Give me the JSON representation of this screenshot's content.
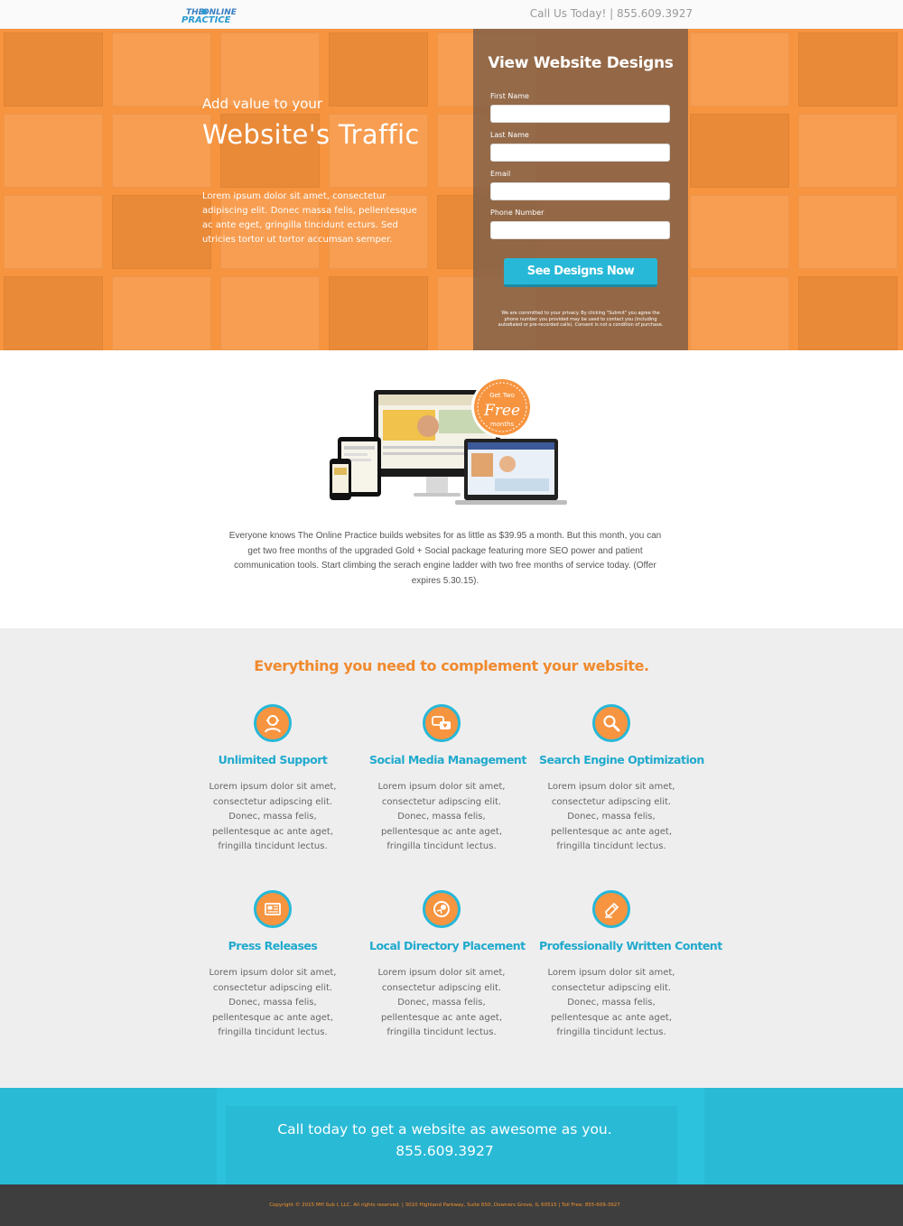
{
  "header": {
    "logo_alt": "The Online Practice",
    "call": "Call Us Today! | 855.609.3927"
  },
  "hero": {
    "pre_title": "Add value to your",
    "title": "Website's Traffic",
    "body": "Lorem ipsum dolor sit amet, consectetur adipiscing elit. Donec massa felis, pellentesque ac ante eget, gringilla tincidunt ecturs. Sed utricies tortor ut tortor accumsan semper."
  },
  "form": {
    "title": "View Website Designs",
    "fields": [
      {
        "label": "First Name",
        "value": ""
      },
      {
        "label": "Last Name",
        "value": ""
      },
      {
        "label": "Email",
        "value": ""
      },
      {
        "label": "Phone Number",
        "value": ""
      }
    ],
    "submit_label": "See Designs Now",
    "privacy": "We are committed to your privacy. By clicking \"Submit\" you agree the phone number you provided may be used to contact you (including autodialed or pre-recorded calls). Consent is not a condition of purchase."
  },
  "offer": {
    "badge_top": "Get Two",
    "badge_main": "Free",
    "badge_bottom": "months",
    "text": "Everyone knows The Online Practice builds websites for as little as $39.95 a month. But this month, you can get two free months of the upgraded Gold + Social package featuring more SEO power and patient communication tools. Start climbing the serach engine ladder with two free months of service today. (Offer expires 5.30.15)."
  },
  "features": {
    "heading": "Everything you need to complement your website.",
    "items": [
      {
        "icon": "support-icon",
        "title": "Unlimited Support",
        "body": "Lorem ipsum dolor sit amet, consectetur adipscing elit. Donec, massa felis, pellentesque ac ante aget, fringilla tincidunt lectus."
      },
      {
        "icon": "social-media-icon",
        "title": "Social Media Management",
        "body": "Lorem ipsum dolor sit amet, consectetur adipscing elit. Donec, massa felis, pellentesque ac ante aget, fringilla tincidunt lectus."
      },
      {
        "icon": "magnifier-icon",
        "title": "Search Engine Optimization",
        "body": "Lorem ipsum dolor sit amet, consectetur adipscing elit. Donec, massa felis, pellentesque ac ante aget, fringilla tincidunt lectus."
      },
      {
        "icon": "newspaper-icon",
        "title": "Press Releases",
        "body": "Lorem ipsum dolor sit amet, consectetur adipscing elit. Donec, massa felis, pellentesque ac ante aget, fringilla tincidunt lectus."
      },
      {
        "icon": "location-icon",
        "title": "Local Directory Placement",
        "body": "Lorem ipsum dolor sit amet, consectetur adipscing elit. Donec, massa felis, pellentesque ac ante aget, fringilla tincidunt lectus."
      },
      {
        "icon": "pencil-icon",
        "title": "Professionally Written Content",
        "body": "Lorem ipsum dolor sit amet, consectetur adipscing elit. Donec, massa felis, pellentesque ac ante aget, fringilla tincidunt lectus."
      }
    ]
  },
  "cta": {
    "line1": "Call today to get a website as awesome as you.",
    "line2": "855.609.3927"
  },
  "footer": {
    "text": "Copyright © 2015 MH Sub I, LLC. All rights reserved. | 3010 Highland Parkway, Suite 650, Downers Grove, IL 60515 | Toll Free: 855-609-3927"
  },
  "colors": {
    "orange": "#f7943f",
    "blue": "#27b8d8",
    "footer_bg": "#3e3e3e"
  }
}
